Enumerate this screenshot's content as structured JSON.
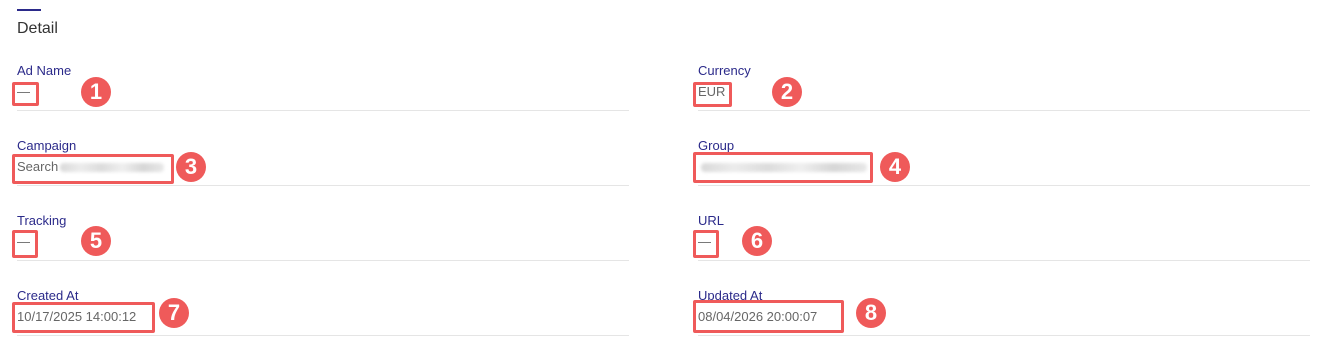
{
  "section": {
    "title": "Detail"
  },
  "fields": {
    "ad_name": {
      "label": "Ad Name",
      "value": "—"
    },
    "currency": {
      "label": "Currency",
      "value": "EUR"
    },
    "campaign": {
      "label": "Campaign",
      "value": "Search"
    },
    "group": {
      "label": "Group",
      "value": ""
    },
    "tracking": {
      "label": "Tracking",
      "value": "—"
    },
    "url": {
      "label": "URL",
      "value": "—"
    },
    "created_at": {
      "label": "Created At",
      "value": "10/17/2025 14:00:12"
    },
    "updated_at": {
      "label": "Updated At",
      "value": "08/04/2026 20:00:07"
    }
  },
  "annotations": [
    "1",
    "2",
    "3",
    "4",
    "5",
    "6",
    "7",
    "8"
  ],
  "colors": {
    "label": "#2b2a8a",
    "annotation": "#ef5a5a",
    "value": "#666666"
  }
}
